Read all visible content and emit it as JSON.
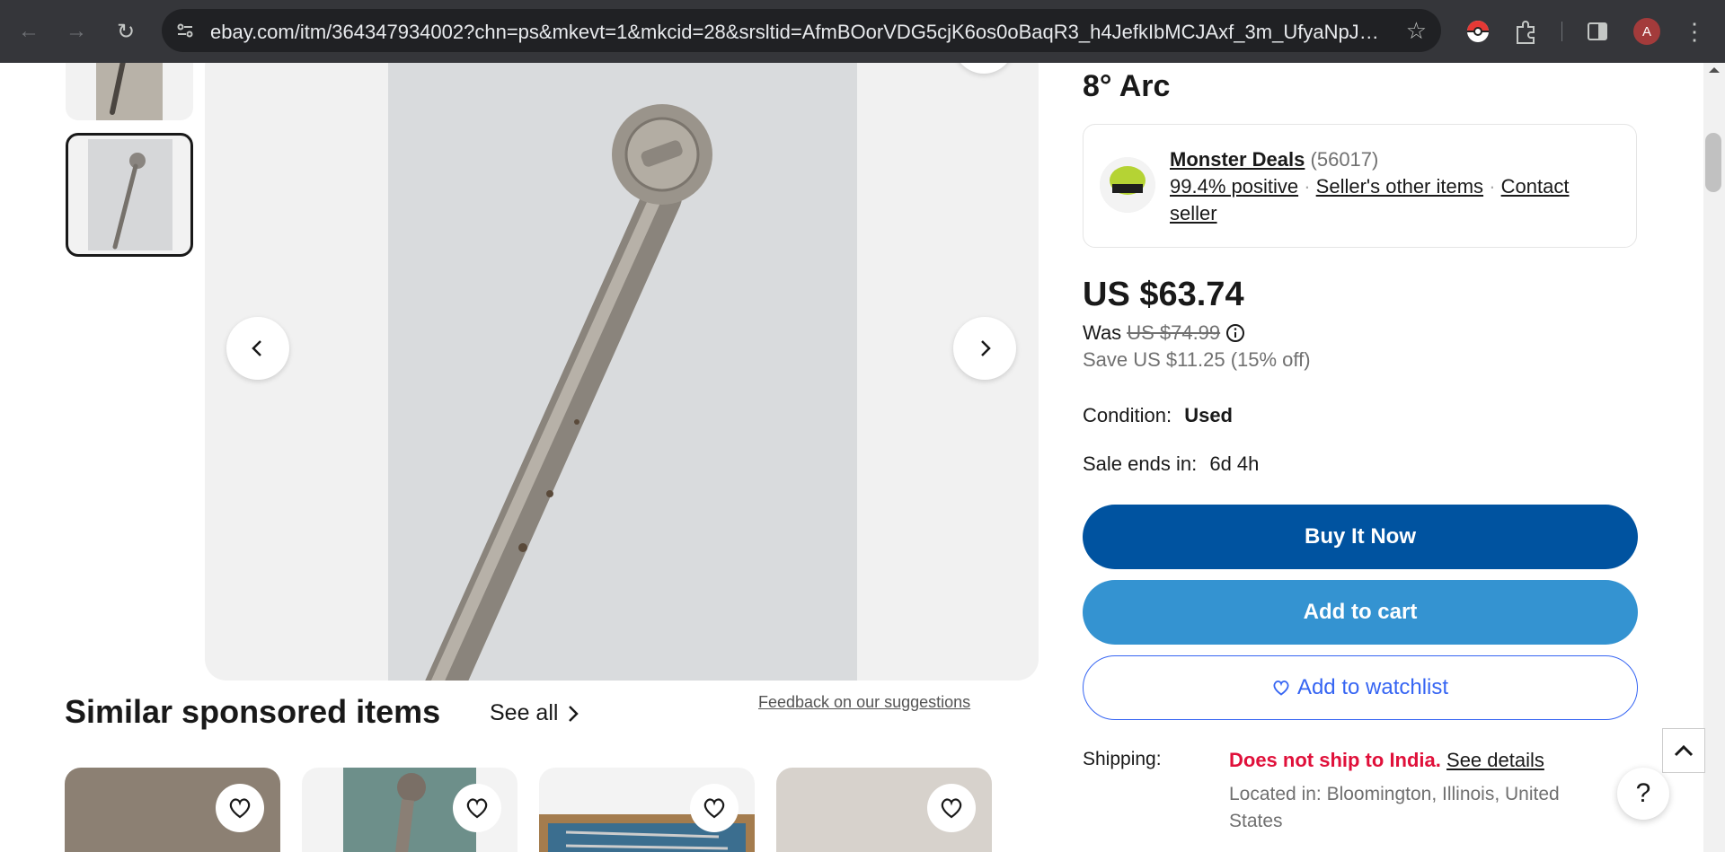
{
  "browser": {
    "url": "ebay.com/itm/364347934002?chn=ps&mkevt=1&mkcid=28&srsltid=AfmBOorVDG5cjK6os0oBaqR3_h4JefkIbMCJAxf_3m_UfyaNpJWhQ8up...",
    "profile_initial": "A"
  },
  "listing": {
    "title_fragment": "8° Arc"
  },
  "seller": {
    "name": "Monster Deals",
    "feedback_count": "(56017)",
    "positive": "99.4% positive",
    "other_items": "Seller's other items",
    "contact": "Contact seller"
  },
  "pricing": {
    "price": "US $63.74",
    "was_label": "Was",
    "was_price": "US $74.99",
    "savings": "Save US $11.25 (15% off)"
  },
  "condition": {
    "label": "Condition:",
    "value": "Used"
  },
  "sale": {
    "label": "Sale ends in:",
    "value": "6d 4h"
  },
  "actions": {
    "buy_now": "Buy It Now",
    "add_to_cart": "Add to cart",
    "watchlist": "Add to watchlist"
  },
  "shipping": {
    "label": "Shipping:",
    "warning": "Does not ship to India.",
    "details_link": "See details",
    "location": "Located in: Bloomington, Illinois, United States"
  },
  "similar": {
    "title": "Similar sponsored items",
    "see_all": "See all",
    "feedback": "Feedback on our suggestions"
  },
  "colors": {
    "buy_now_bg": "#0053a0",
    "add_to_cart_bg": "#3493d1",
    "watchlist_border": "#3665f3",
    "warning": "#e0103a"
  }
}
